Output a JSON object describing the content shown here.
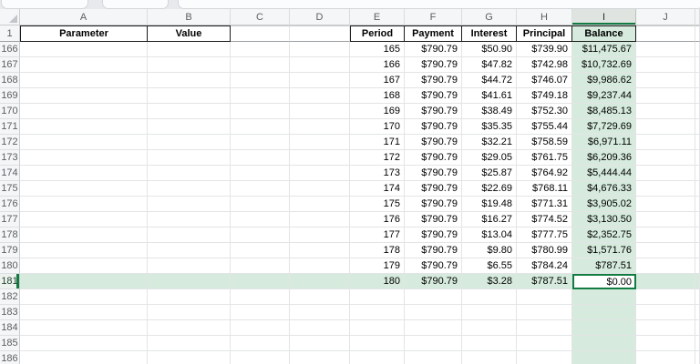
{
  "sheet": {
    "column_letters": [
      "A",
      "B",
      "C",
      "D",
      "E",
      "F",
      "G",
      "H",
      "I",
      "J"
    ],
    "selected_column_letter": "I",
    "selected_row_number": 181,
    "visible_row_numbers": [
      1,
      166,
      167,
      168,
      169,
      170,
      171,
      172,
      173,
      174,
      175,
      176,
      177,
      178,
      179,
      180,
      181,
      182,
      183,
      184,
      185,
      186
    ],
    "header_row": {
      "A": "Parameter",
      "B": "Value",
      "E": "Period",
      "F": "Payment",
      "G": "Interest",
      "H": "Principal",
      "I": "Balance"
    },
    "schedule": {
      "columns": [
        "Period",
        "Payment",
        "Interest",
        "Principal",
        "Balance"
      ],
      "rows": [
        {
          "row": 166,
          "period": "165",
          "payment": "$790.79",
          "interest": "$50.90",
          "principal": "$739.90",
          "balance": "$11,475.67"
        },
        {
          "row": 167,
          "period": "166",
          "payment": "$790.79",
          "interest": "$47.82",
          "principal": "$742.98",
          "balance": "$10,732.69"
        },
        {
          "row": 168,
          "period": "167",
          "payment": "$790.79",
          "interest": "$44.72",
          "principal": "$746.07",
          "balance": "$9,986.62"
        },
        {
          "row": 169,
          "period": "168",
          "payment": "$790.79",
          "interest": "$41.61",
          "principal": "$749.18",
          "balance": "$9,237.44"
        },
        {
          "row": 170,
          "period": "169",
          "payment": "$790.79",
          "interest": "$38.49",
          "principal": "$752.30",
          "balance": "$8,485.13"
        },
        {
          "row": 171,
          "period": "170",
          "payment": "$790.79",
          "interest": "$35.35",
          "principal": "$755.44",
          "balance": "$7,729.69"
        },
        {
          "row": 172,
          "period": "171",
          "payment": "$790.79",
          "interest": "$32.21",
          "principal": "$758.59",
          "balance": "$6,971.11"
        },
        {
          "row": 173,
          "period": "172",
          "payment": "$790.79",
          "interest": "$29.05",
          "principal": "$761.75",
          "balance": "$6,209.36"
        },
        {
          "row": 174,
          "period": "173",
          "payment": "$790.79",
          "interest": "$25.87",
          "principal": "$764.92",
          "balance": "$5,444.44"
        },
        {
          "row": 175,
          "period": "174",
          "payment": "$790.79",
          "interest": "$22.69",
          "principal": "$768.11",
          "balance": "$4,676.33"
        },
        {
          "row": 176,
          "period": "175",
          "payment": "$790.79",
          "interest": "$19.48",
          "principal": "$771.31",
          "balance": "$3,905.02"
        },
        {
          "row": 177,
          "period": "176",
          "payment": "$790.79",
          "interest": "$16.27",
          "principal": "$774.52",
          "balance": "$3,130.50"
        },
        {
          "row": 178,
          "period": "177",
          "payment": "$790.79",
          "interest": "$13.04",
          "principal": "$777.75",
          "balance": "$2,352.75"
        },
        {
          "row": 179,
          "period": "178",
          "payment": "$790.79",
          "interest": "$9.80",
          "principal": "$780.99",
          "balance": "$1,571.76"
        },
        {
          "row": 180,
          "period": "179",
          "payment": "$790.79",
          "interest": "$6.55",
          "principal": "$784.24",
          "balance": "$787.51"
        },
        {
          "row": 181,
          "period": "180",
          "payment": "$790.79",
          "interest": "$3.28",
          "principal": "$787.51",
          "balance": "$0.00"
        }
      ]
    },
    "active_cell": {
      "ref": "I181",
      "value": "$0.00"
    },
    "colors": {
      "accent_green": "#107c41",
      "selection_tint": "#d6ebdd",
      "selected_header_fill": "#dfe4e0",
      "header_band_fill": "#f5f6f7",
      "table_border": "#1a1a1a"
    }
  }
}
